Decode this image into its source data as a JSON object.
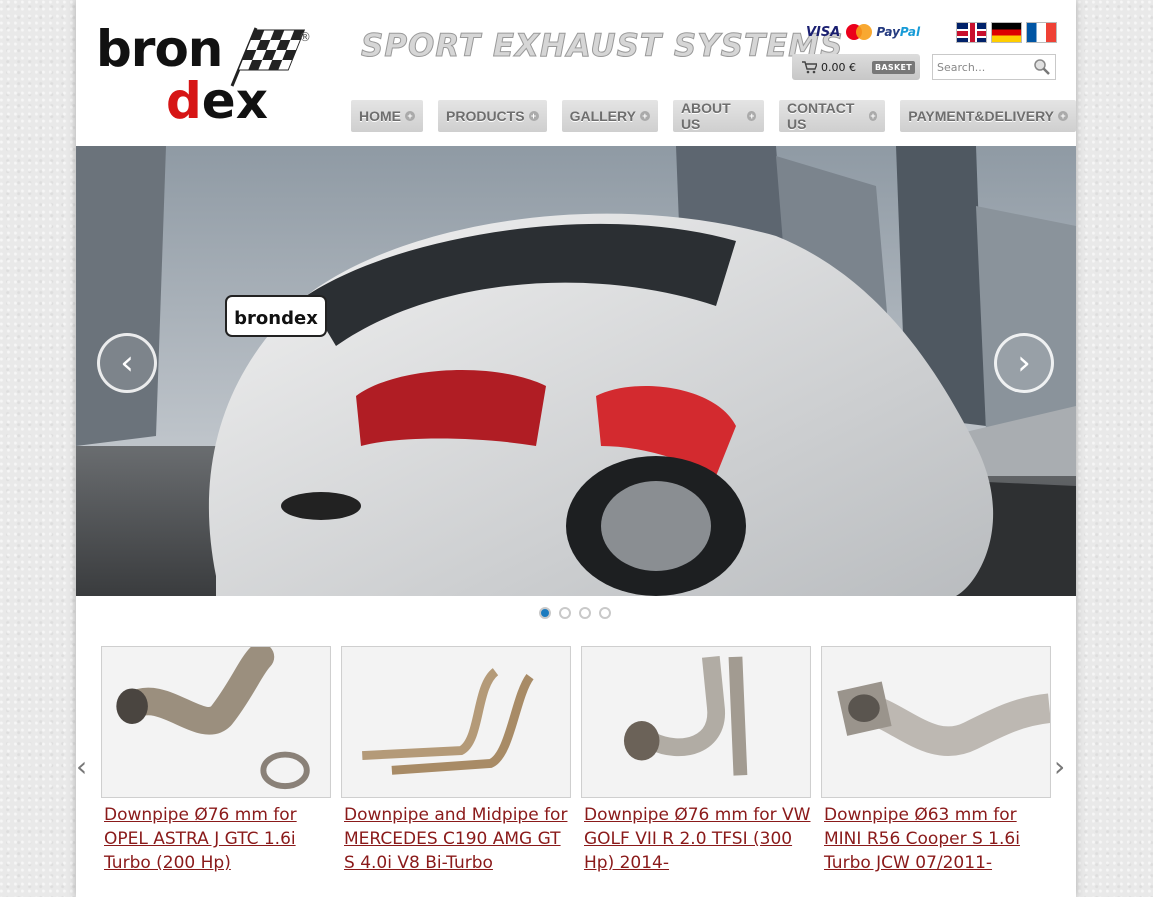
{
  "header": {
    "logo": {
      "line1": "bron",
      "line2_a": "d",
      "line2_b": "ex",
      "reg": "®"
    },
    "tagline": "SPORT EXHAUST SYSTEMS",
    "payments": {
      "visa": "VISA",
      "mastercard": "MasterCard",
      "paypal_a": "Pay",
      "paypal_b": "Pal"
    },
    "languages": [
      "English",
      "Deutsch",
      "Français"
    ],
    "basket": {
      "amount": "0.00 €",
      "label": "BASKET"
    },
    "search": {
      "placeholder": "Search..."
    }
  },
  "nav": {
    "items": [
      {
        "label": "HOME"
      },
      {
        "label": "PRODUCTS"
      },
      {
        "label": "GALLERY"
      },
      {
        "label": "ABOUT US"
      },
      {
        "label": "CONTACT US"
      },
      {
        "label": "PAYMENT&DELIVERY"
      }
    ]
  },
  "slider": {
    "prev": "‹",
    "next": "›",
    "plate_text": "brondex",
    "dots": 4,
    "active_dot": 1
  },
  "products": {
    "prev": "‹",
    "next": "›",
    "items": [
      {
        "title": "Downpipe Ø76 mm for OPEL ASTRA J GTC 1.6i Turbo (200 Hp)"
      },
      {
        "title": "Downpipe and Midpipe for MERCEDES C190 AMG GT S 4.0i V8 Bi-Turbo"
      },
      {
        "title": "Downpipe Ø76 mm for VW GOLF VII R 2.0 TFSI (300 Hp) 2014-"
      },
      {
        "title": "Downpipe Ø63 mm for MINI R56 Cooper S 1.6i Turbo JCW 07/2011-"
      }
    ]
  },
  "colors": {
    "accent": "#d61515",
    "link": "#8a1a1a",
    "active_dot": "#1c7bbf"
  }
}
